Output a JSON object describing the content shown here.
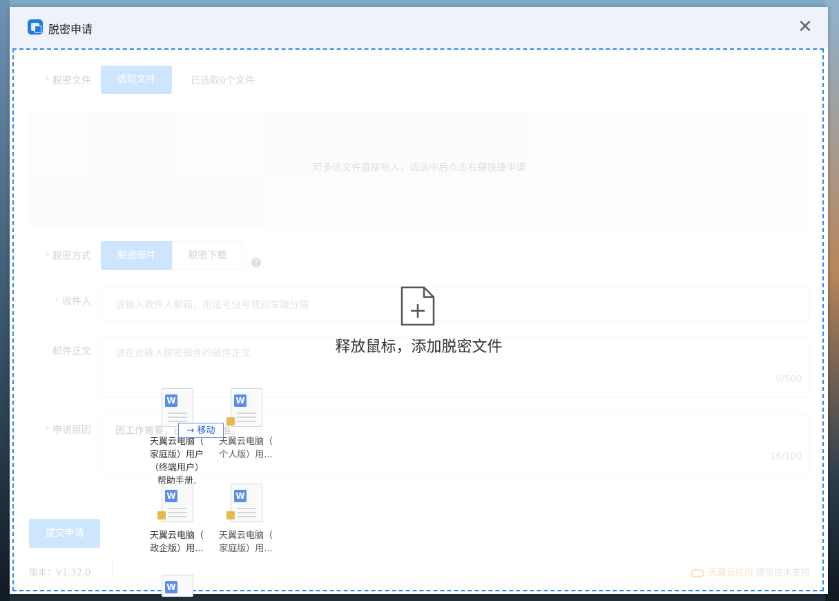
{
  "window": {
    "title": "脱密申请"
  },
  "form": {
    "file_label": "脱密文件",
    "select_button": "选取文件",
    "selected_count": "已选取0个文件",
    "drop_hint": "可多选文件直接拖入，或选中后点击右键快捷申请",
    "method_label": "脱密方式",
    "method_options": [
      "脱密邮件",
      "脱密下载"
    ],
    "recipient_label": "收件人",
    "recipient_placeholder": "请输入收件人邮箱，用逗号分号或回车键分隔",
    "body_label": "邮件正文",
    "body_placeholder": "请在此输入脱密邮件的邮件正文",
    "body_counter": "0/500",
    "reason_label": "申请原因",
    "reason_value": "因工作需要，已经领导批准。",
    "reason_counter": "16/100",
    "submit_button": "提交申请"
  },
  "overlay": {
    "text": "释放鼠标，添加脱密文件"
  },
  "footer": {
    "version": "版本：V1.32.0",
    "brand": "天翼云应用",
    "support": "提供技术支持"
  },
  "drag": {
    "move_tip": "→ 移动",
    "files": [
      {
        "line1": "天翼云电脑（",
        "line2": "家庭版）用户",
        "line3": "（终端用户）",
        "line4": "帮助手册."
      },
      {
        "line1": "天翼云电脑（",
        "line2": "个人版）用..."
      },
      {
        "line1": "天翼云电脑（",
        "line2": "政企版）用..."
      },
      {
        "line1": "天翼云电脑（",
        "line2": "家庭版）用..."
      }
    ]
  },
  "colors": {
    "accent": "#409eff",
    "dropzone_border": "#2f86f0",
    "brand": "#f08a24"
  }
}
